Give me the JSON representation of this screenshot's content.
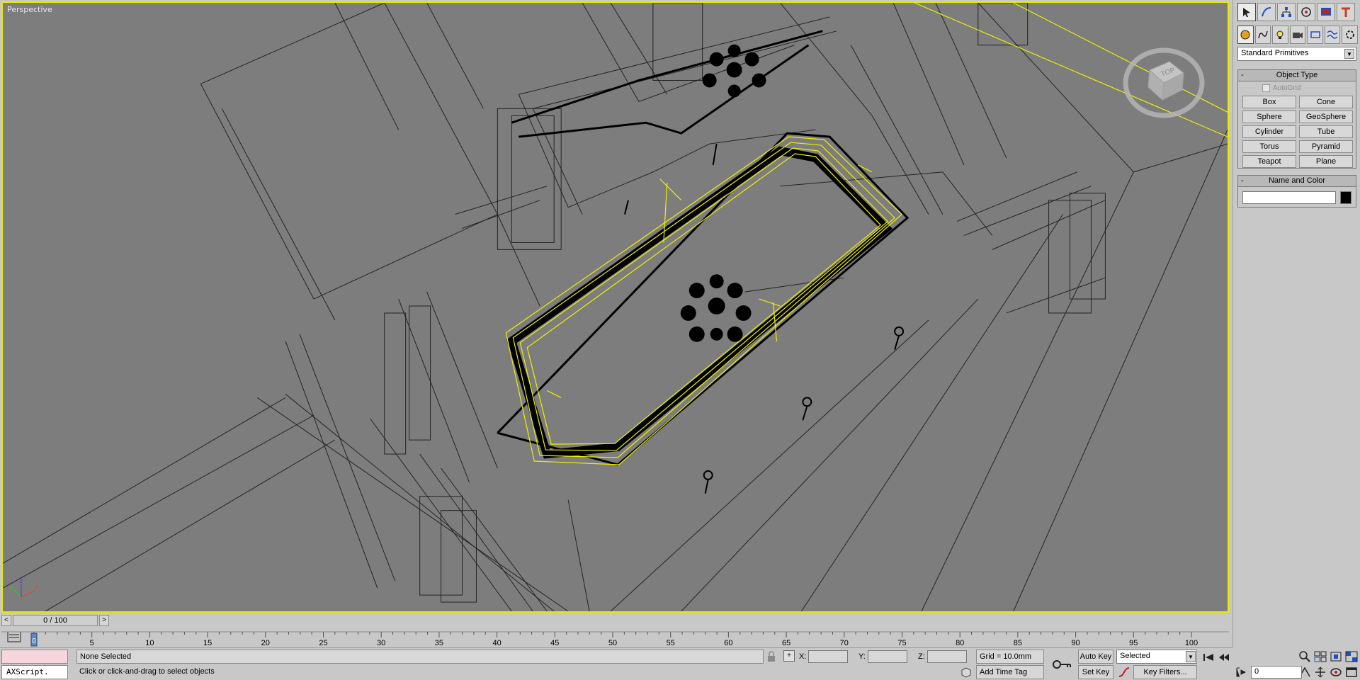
{
  "viewport": {
    "label": "Perspective",
    "viewcube_label": "TOP"
  },
  "command_panel": {
    "tabs": [
      "create-tab",
      "modify-tab",
      "hierarchy-tab",
      "motion-tab",
      "display-tab",
      "utilities-tab"
    ],
    "sub_tabs": [
      "geometry-tab",
      "shapes-tab",
      "lights-tab",
      "cameras-tab",
      "helpers-tab",
      "spacewarps-tab",
      "systems-tab"
    ],
    "category": "Standard Primitives",
    "object_type_title": "Object Type",
    "autogrid_label": "AutoGrid",
    "primitives": [
      "Box",
      "Cone",
      "Sphere",
      "GeoSphere",
      "Cylinder",
      "Tube",
      "Torus",
      "Pyramid",
      "Teapot",
      "Plane"
    ],
    "name_color_title": "Name and Color",
    "collapse_symbol": "-",
    "object_color": "#000000"
  },
  "timeslider": {
    "frame_display": "0 / 100",
    "prev": "<",
    "next": ">"
  },
  "trackbar": {
    "ticks": [
      "0",
      "5",
      "10",
      "15",
      "20",
      "25",
      "30",
      "35",
      "40",
      "45",
      "50",
      "55",
      "60",
      "65",
      "70",
      "75",
      "80",
      "85",
      "90",
      "95",
      "100"
    ],
    "start": 0,
    "end": 100,
    "current": 0
  },
  "status": {
    "maxscript_label": "AXScript.",
    "selection_info": "None Selected",
    "prompt": "Click or click-and-drag to select objects",
    "x_label": "X:",
    "y_label": "Y:",
    "z_label": "Z:",
    "grid": "Grid = 10.0mm",
    "add_time_tag": "Add Time Tag",
    "auto_key": "Auto Key",
    "set_key": "Set Key",
    "selection_set": "Selected",
    "key_filters": "Key Filters...",
    "current_frame": "0"
  },
  "colors": {
    "viewport_bg": "#7d7d7d",
    "active_border": "#e8e800",
    "selection": "#f0f000",
    "wire": "#000000"
  }
}
